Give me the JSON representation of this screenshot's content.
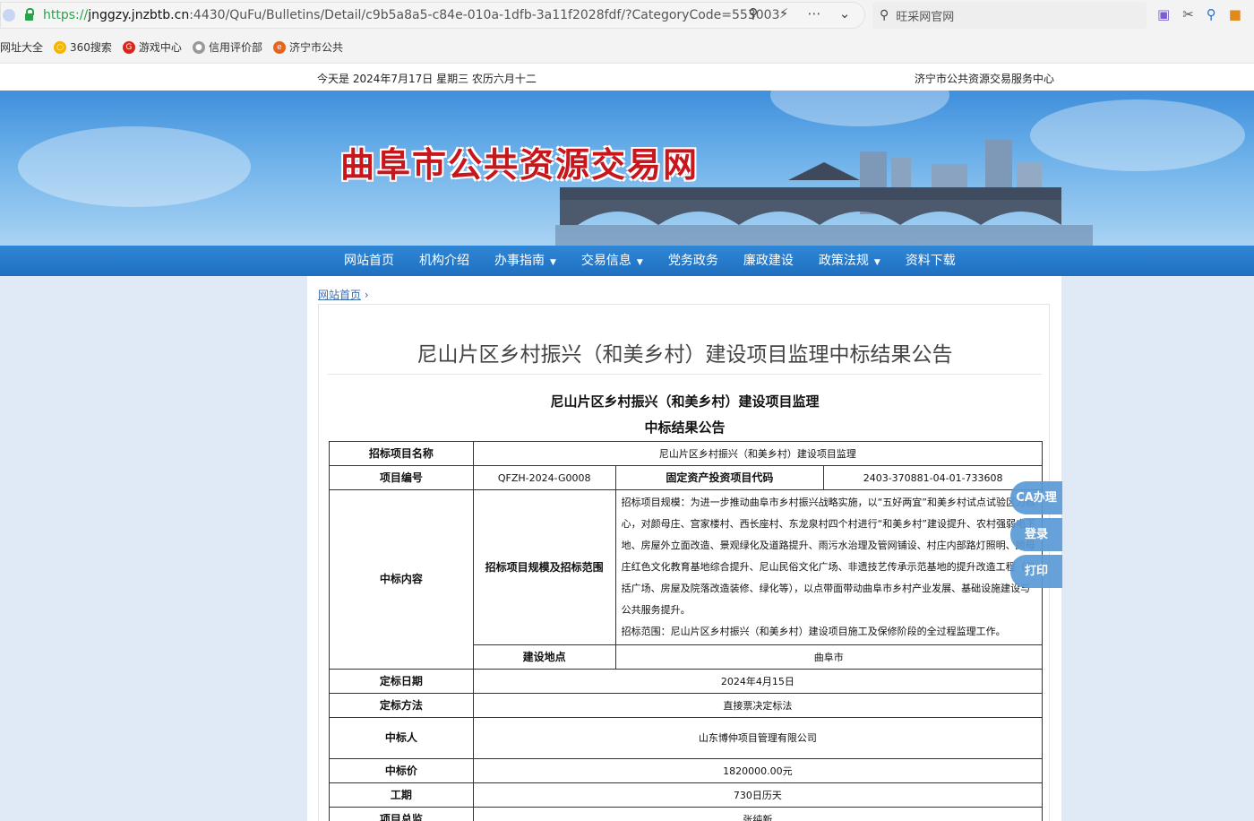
{
  "browser": {
    "url_scheme": "https://",
    "url_host": "jnggzy.jnzbtb.cn",
    "url_rest": ":4430/QuFu/Bulletins/Detail/c9b5a8a5-c84e-010a-1dfb-3a11f2028fdf/?CategoryCode=553003",
    "search_placeholder": "旺采网官网",
    "bookmarks": [
      {
        "label": "网址大全",
        "icon": "bookmark-icon"
      },
      {
        "label": "360搜索",
        "icon": "360-icon"
      },
      {
        "label": "游戏中心",
        "icon": "game-icon"
      },
      {
        "label": "信用评价部",
        "icon": "credit-icon"
      },
      {
        "label": "济宁市公共",
        "icon": "jining-icon"
      }
    ]
  },
  "topbar": {
    "date": "今天是 2024年7月17日 星期三 农历六月十二",
    "center": "济宁市公共资源交易服务中心"
  },
  "banner": {
    "title": "曲阜市公共资源交易网"
  },
  "nav": {
    "items": [
      {
        "label": "网站首页",
        "dropdown": false
      },
      {
        "label": "机构介绍",
        "dropdown": false
      },
      {
        "label": "办事指南",
        "dropdown": true
      },
      {
        "label": "交易信息",
        "dropdown": true
      },
      {
        "label": "党务政务",
        "dropdown": false
      },
      {
        "label": "廉政建设",
        "dropdown": false
      },
      {
        "label": "政策法规",
        "dropdown": true
      },
      {
        "label": "资料下载",
        "dropdown": false
      }
    ]
  },
  "breadcrumb": {
    "home": "网站首页",
    "sep": "›"
  },
  "article": {
    "title": "尼山片区乡村振兴（和美乡村）建设项目监理中标结果公告",
    "subtitle1": "尼山片区乡村振兴（和美乡村）建设项目监理",
    "subtitle2": "中标结果公告"
  },
  "table": {
    "project_name_label": "招标项目名称",
    "project_name": "尼山片区乡村振兴（和美乡村）建设项目监理",
    "project_no_label": "项目编号",
    "project_no": "QFZH-2024-G0008",
    "invest_code_label": "固定资产投资项目代码",
    "invest_code": "2403-370881-04-01-733608",
    "content_label": "中标内容",
    "scope_label": "招标项目规模及招标范围",
    "scale_text": "招标项目规模：为进一步推动曲阜市乡村振兴战略实施，以“五好两宜”和美乡村试点试验区为核心，对颜母庄、宫家楼村、西长座村、东龙泉村四个村进行“和美乡村”建设提升、农村强弱电下地、房屋外立面改造、景观绿化及道路提升、雨污水治理及管网铺设、村庄内部路灯照明、颜母庄红色文化教育基地综合提升、尼山民俗文化广场、非遗技艺传承示范基地的提升改造工程（包括广场、房屋及院落改造装修、绿化等），以点带面带动曲阜市乡村产业发展、基础设施建设与公共服务提升。",
    "range_text": "招标范围：尼山片区乡村振兴（和美乡村）建设项目施工及保修阶段的全过程监理工作。",
    "location_label": "建设地点",
    "location": "曲阜市",
    "date_label": "定标日期",
    "date": "2024年4月15日",
    "method_label": "定标方法",
    "method": "直接票决定标法",
    "winner_label": "中标人",
    "winner": "山东博仲项目管理有限公司",
    "price_label": "中标价",
    "price": "1820000.00元",
    "duration_label": "工期",
    "duration": "730日历天",
    "supervisor_label": "项目总监",
    "supervisor": "张纯新"
  },
  "float_buttons": [
    "CA办理",
    "登录",
    "打印"
  ]
}
